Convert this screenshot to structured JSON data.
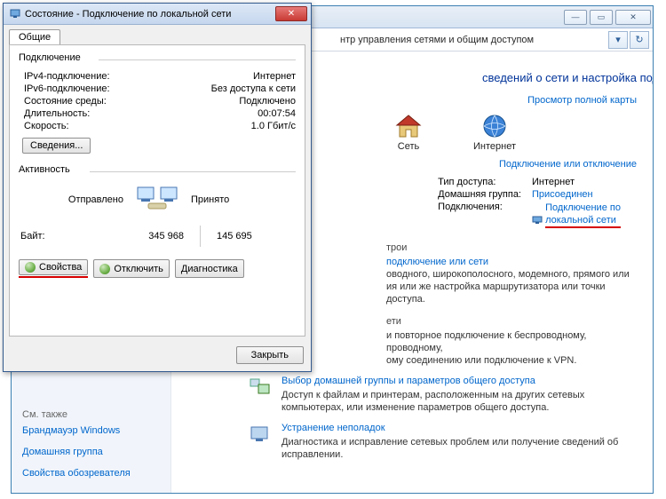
{
  "bg": {
    "breadcrumb": "нтр управления сетями и общим доступом",
    "heading": "сведений о сети и настройка подключений",
    "map": {
      "network": "Сеть",
      "internet": "Интернет"
    },
    "full_map": "Просмотр полной карты",
    "conn_or_disc": "Подключение или отключение",
    "conn": {
      "access_label": "Тип доступа:",
      "access_value": "Интернет",
      "homegroup_label": "Домашняя группа:",
      "homegroup_value": "Присоединен",
      "connections_label": "Подключения:",
      "connections_value1": "Подключение по",
      "connections_value2": "локальной сети"
    },
    "task1": {
      "head_part": "трои",
      "text_line1": "подключение или сети",
      "text_line2": "оводного, широкополосного, модемного, прямого или",
      "text_line3": "ия или же настройка маршрутизатора или точки доступа."
    },
    "task2": {
      "head_part": "ети",
      "text_line1": "и повторное подключение к беспроводному, проводному,",
      "text_line2": "ому соединению или подключение к VPN."
    },
    "task_hg": {
      "head": "Выбор домашней группы и параметров общего доступа",
      "text": "Доступ к файлам и принтерам, расположенным на других сетевых компьютерах, или изменение параметров общего доступа."
    },
    "task_tr": {
      "head": "Устранение неполадок",
      "text": "Диагностика и исправление сетевых проблем или получение сведений об исправлении."
    },
    "sidebar": {
      "see_also": "См. также",
      "firewall": "Брандмауэр Windows",
      "homegroup": "Домашняя группа",
      "browser": "Свойства обозревателя"
    }
  },
  "dlg": {
    "title": "Состояние - Подключение по локальной сети",
    "tab_general": "Общие",
    "group_conn": "Подключение",
    "ipv4_label": "IPv4-подключение:",
    "ipv4_value": "Интернет",
    "ipv6_label": "IPv6-подключение:",
    "ipv6_value": "Без доступа к сети",
    "media_label": "Состояние среды:",
    "media_value": "Подключено",
    "duration_label": "Длительность:",
    "duration_value": "00:07:54",
    "speed_label": "Скорость:",
    "speed_value": "1.0 Гбит/с",
    "details": "Сведения...",
    "group_activity": "Активность",
    "sent": "Отправлено",
    "received": "Принято",
    "bytes_label": "Байт:",
    "bytes_sent": "345 968",
    "bytes_recv": "145 695",
    "properties": "Свойства",
    "disable": "Отключить",
    "diagnose": "Диагностика",
    "close": "Закрыть"
  }
}
